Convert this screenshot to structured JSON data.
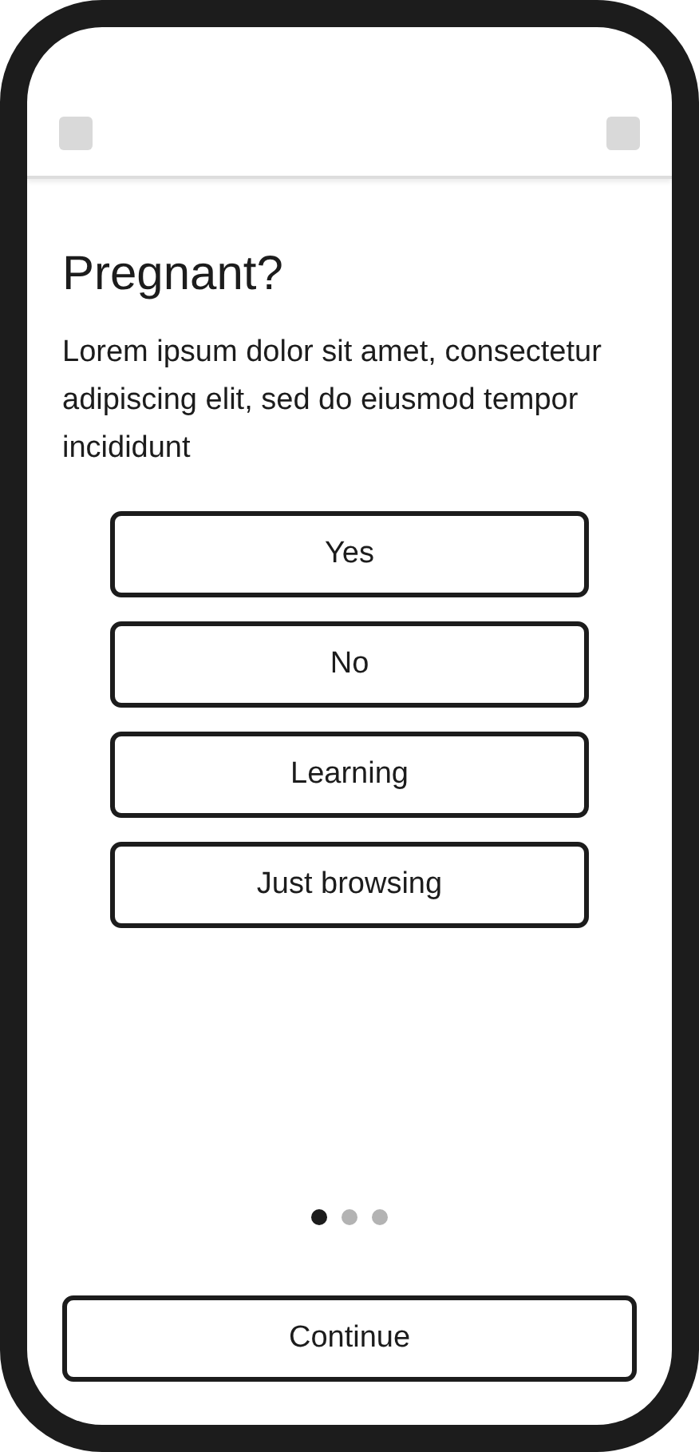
{
  "title": "Pregnant?",
  "description": "Lorem ipsum dolor sit amet, consectetur adipiscing elit, sed do eiusmod tempor incididunt",
  "options": [
    {
      "label": "Yes"
    },
    {
      "label": "No"
    },
    {
      "label": "Learning"
    },
    {
      "label": "Just browsing"
    }
  ],
  "pager_dots": [
    {
      "selected": true
    },
    {
      "selected": false
    },
    {
      "selected": false
    }
  ],
  "primary_button": "Continue"
}
